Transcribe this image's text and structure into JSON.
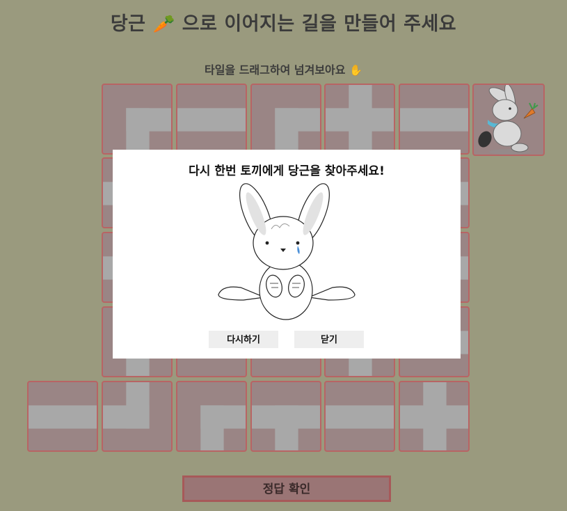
{
  "header": {
    "title_pre": "당근",
    "title_emoji": "🥕",
    "title_post": "으로 이어지는 길을 만들어 주세요",
    "subtitle": "타일을 드래그하여 넘겨보아요",
    "subtitle_emoji": "✋"
  },
  "modal": {
    "title": "다시 한번 토끼에게 당근을 찾아주세요!",
    "retry_label": "다시하기",
    "close_label": "닫기"
  },
  "footer": {
    "check_label": "정답 확인"
  },
  "colors": {
    "background": "#9a9a7e",
    "tile_fill": "#9a8585",
    "tile_border": "#b86464",
    "path": "#a8a8a8",
    "modal": "#ffffff"
  },
  "tiles": [
    {
      "id": "r1c1",
      "path": "corner-right-down"
    },
    {
      "id": "r1c2",
      "path": "horizontal"
    },
    {
      "id": "r1c3",
      "path": "corner-right-down"
    },
    {
      "id": "r1c4",
      "path": "cross"
    },
    {
      "id": "r1c5",
      "path": "horizontal"
    },
    {
      "id": "r2c1",
      "path": "horizontal"
    },
    {
      "id": "r2c2",
      "path": "horizontal"
    },
    {
      "id": "r2c3",
      "path": "horizontal"
    },
    {
      "id": "r2c4",
      "path": "horizontal"
    },
    {
      "id": "r2c5",
      "path": "horizontal"
    },
    {
      "id": "r3c1",
      "path": "horizontal"
    },
    {
      "id": "r3c2",
      "path": "horizontal"
    },
    {
      "id": "r3c3",
      "path": "horizontal"
    },
    {
      "id": "r3c4",
      "path": "horizontal"
    },
    {
      "id": "r3c5",
      "path": "horizontal"
    },
    {
      "id": "r4c1",
      "path": "vertical"
    },
    {
      "id": "r4c2",
      "path": "horizontal"
    },
    {
      "id": "r4c3",
      "path": "horizontal"
    },
    {
      "id": "r4c4",
      "path": "vertical"
    },
    {
      "id": "r4c5",
      "path": "horizontal"
    },
    {
      "id": "r5c0",
      "path": "horizontal"
    },
    {
      "id": "r5c1",
      "path": "corner-up-left"
    },
    {
      "id": "r5c2",
      "path": "corner-right-down"
    },
    {
      "id": "r5c3",
      "path": "tee-down"
    },
    {
      "id": "r5c4",
      "path": "horizontal"
    },
    {
      "id": "r5c5",
      "path": "cross"
    }
  ]
}
